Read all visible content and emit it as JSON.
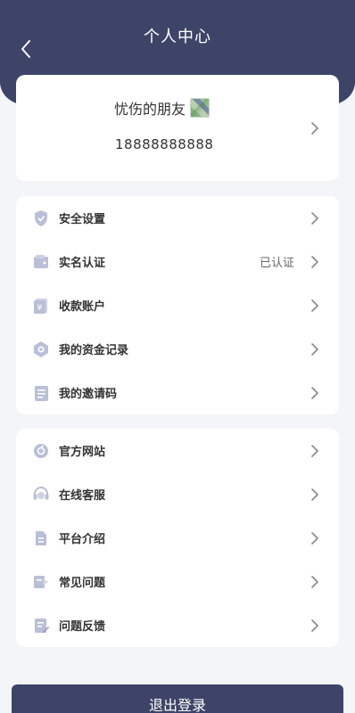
{
  "header": {
    "title": "个人中心",
    "back_icon": "chevron-left-icon",
    "background_color": "#3d4467"
  },
  "profile": {
    "username": "忧伤的朋友",
    "phone": "18888888888",
    "avatar_icon": "avatar-image"
  },
  "menu_group_1": [
    {
      "label": "安全设置",
      "icon": "shield-icon"
    },
    {
      "label": "实名认证",
      "icon": "wallet-icon",
      "status": "已认证"
    },
    {
      "label": "收款账户",
      "icon": "receipt-icon"
    },
    {
      "label": "我的资金记录",
      "icon": "fund-record-icon"
    },
    {
      "label": "我的邀请码",
      "icon": "invite-code-icon"
    }
  ],
  "menu_group_2": [
    {
      "label": "官方网站",
      "icon": "website-icon"
    },
    {
      "label": "在线客服",
      "icon": "headset-icon"
    },
    {
      "label": "平台介绍",
      "icon": "document-icon"
    },
    {
      "label": "常见问题",
      "icon": "faq-icon"
    },
    {
      "label": "问题反馈",
      "icon": "feedback-icon"
    }
  ],
  "logout": {
    "label": "退出登录"
  },
  "colors": {
    "accent": "#3d4467",
    "icon": "#b9bfd6",
    "background": "#f4f5f8"
  }
}
